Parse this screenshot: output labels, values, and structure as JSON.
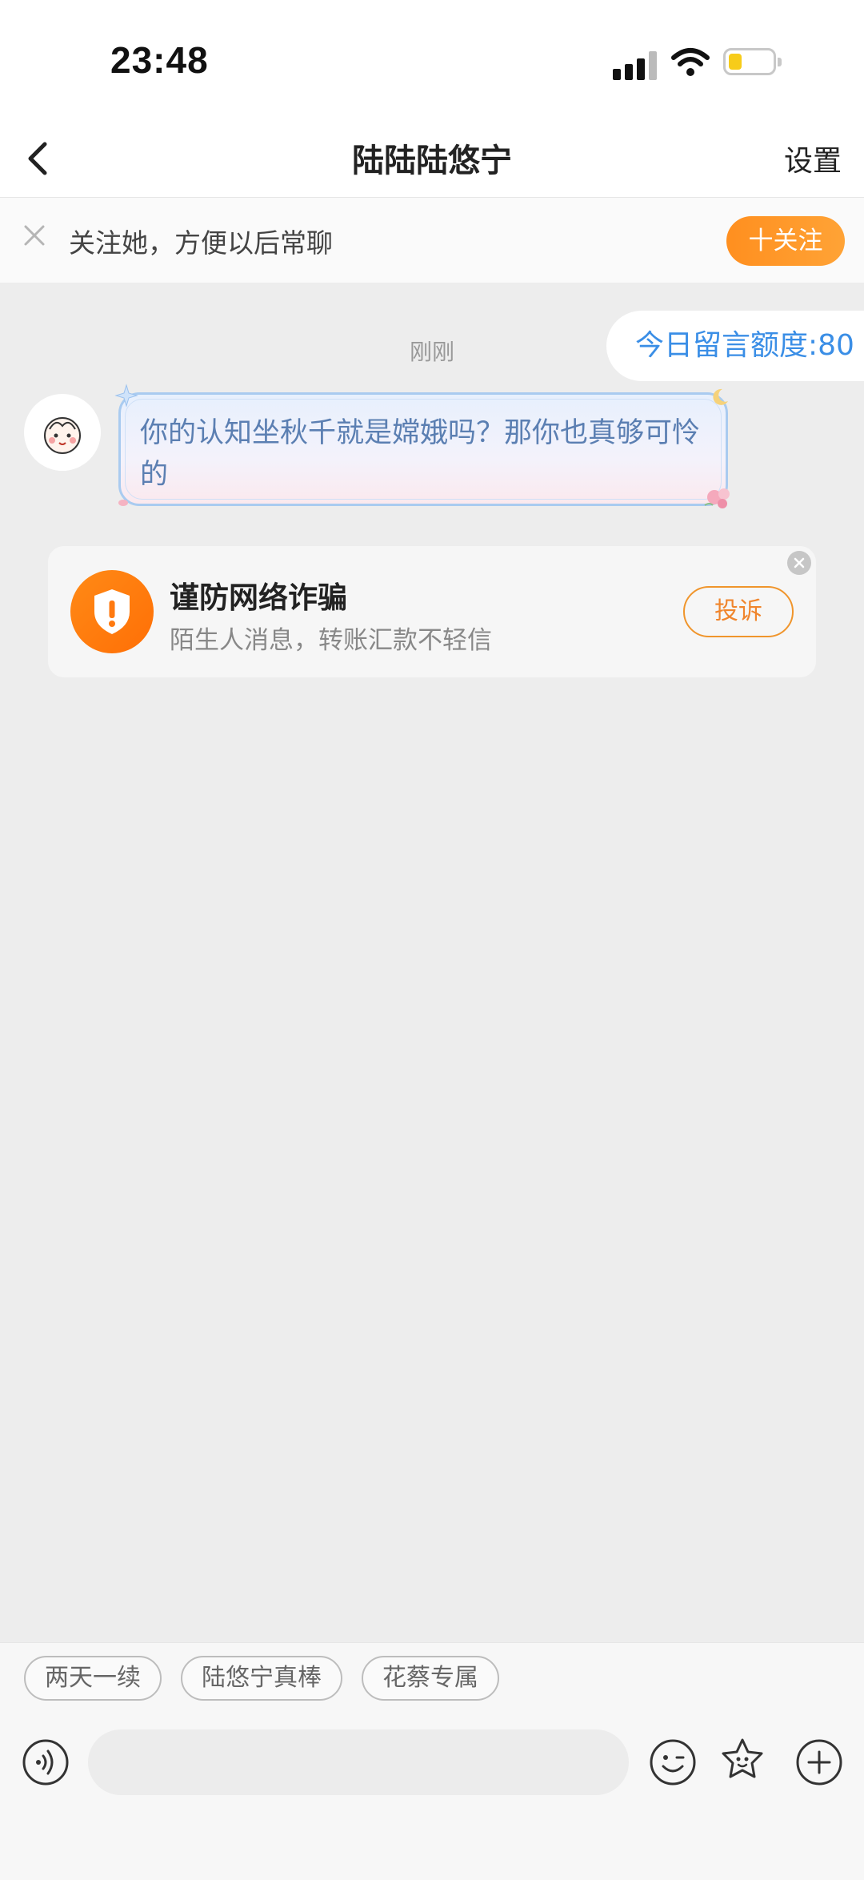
{
  "status_bar": {
    "time": "23:48"
  },
  "nav": {
    "title": "陆陆陆悠宁",
    "settings_label": "设置"
  },
  "follow_bar": {
    "text": "关注她，方便以后常聊",
    "follow_button": "十关注"
  },
  "chat": {
    "quota": "今日留言额度:80",
    "timestamp": "刚刚",
    "message": "你的认知坐秋千就是嫦娥吗？那你也真够可怜的"
  },
  "warning": {
    "title": "谨防网络诈骗",
    "subtitle": "陌生人消息，转账汇款不轻信",
    "report_button": "投诉"
  },
  "quick_replies": [
    "两天一续",
    "陆悠宁真棒",
    "花蔡专属"
  ],
  "colors": {
    "accent_orange": "#ff9a2a",
    "link_blue": "#3a8ee6",
    "bubble_text": "#5b7fb2"
  }
}
